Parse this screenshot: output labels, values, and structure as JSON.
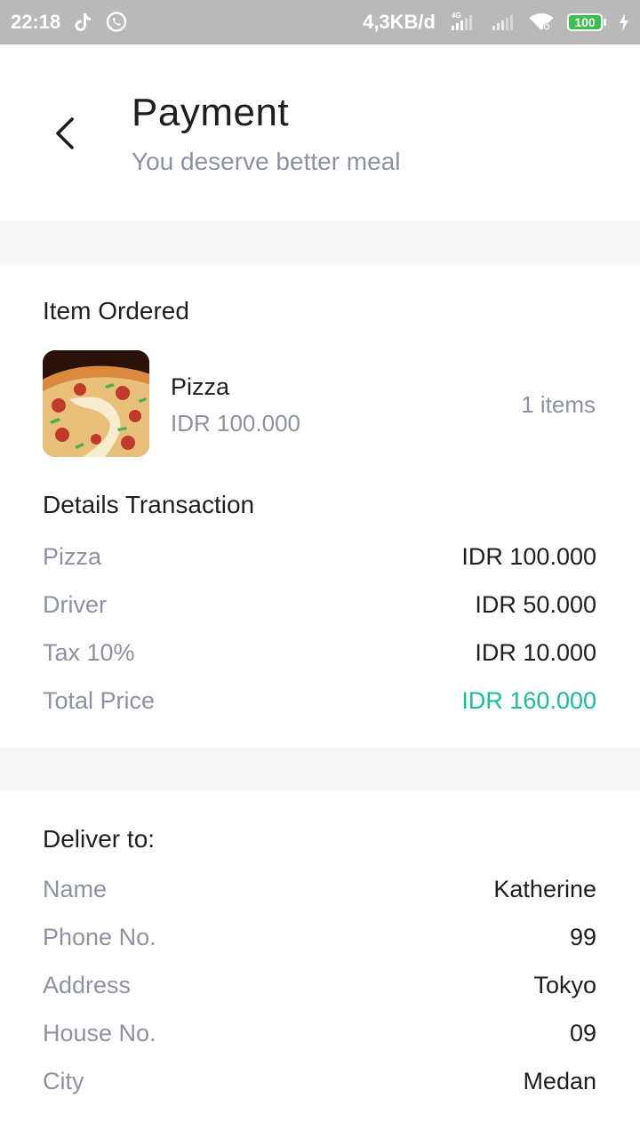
{
  "status_bar": {
    "time": "22:18",
    "network_speed": "4,3KB/d",
    "network_type": "4G",
    "battery": "100",
    "icons": [
      "tiktok-icon",
      "whatsapp-icon",
      "signal-icon",
      "wifi-icon",
      "battery-icon",
      "charging-icon"
    ]
  },
  "header": {
    "title": "Payment",
    "subtitle": "You deserve better meal",
    "back_icon": "chevron-left-icon"
  },
  "item_ordered": {
    "section_title": "Item Ordered",
    "item": {
      "name": "Pizza",
      "price": "IDR 100.000",
      "quantity": "1 items"
    }
  },
  "details_transaction": {
    "section_title": "Details Transaction",
    "rows": [
      {
        "label": "Pizza",
        "value": "IDR 100.000"
      },
      {
        "label": "Driver",
        "value": "IDR 50.000"
      },
      {
        "label": "Tax 10%",
        "value": "IDR 10.000"
      },
      {
        "label": "Total Price",
        "value": "IDR 160.000"
      }
    ]
  },
  "deliver_to": {
    "section_title": "Deliver to:",
    "rows": [
      {
        "label": "Name",
        "value": "Katherine"
      },
      {
        "label": "Phone No.",
        "value": "99"
      },
      {
        "label": "Address",
        "value": "Tokyo"
      },
      {
        "label": "House No.",
        "value": "09"
      },
      {
        "label": "City",
        "value": "Medan"
      }
    ]
  },
  "colors": {
    "accent": "#1abc9c",
    "muted_text": "#8d92a3",
    "band": "#f7f8fa",
    "status_bar": "#b9b9b9"
  }
}
